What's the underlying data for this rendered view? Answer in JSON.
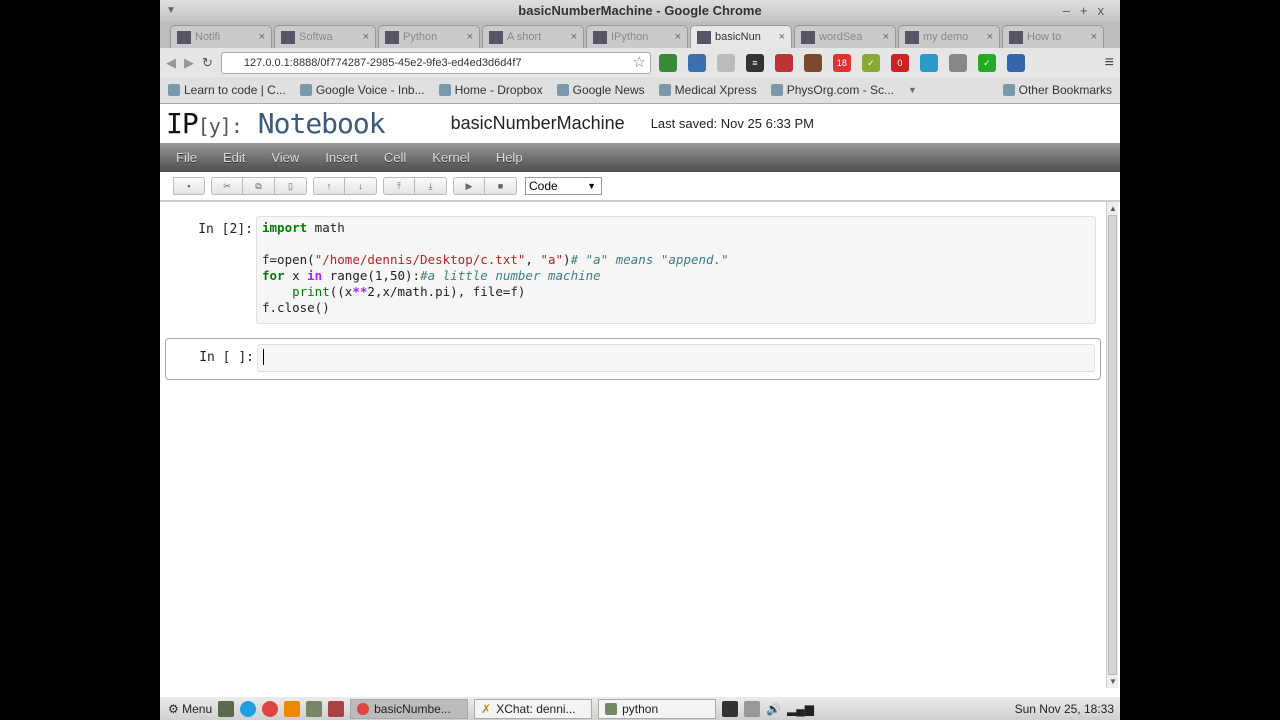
{
  "window": {
    "title": "basicNumberMachine - Google Chrome"
  },
  "tabs": [
    {
      "label": "Notifi",
      "icon": "gmail-icon"
    },
    {
      "label": "Softwa",
      "icon": "power-icon"
    },
    {
      "label": "Python",
      "icon": "google-icon"
    },
    {
      "label": "A short",
      "icon": "grid-icon"
    },
    {
      "label": "IPython",
      "icon": "ipython-icon"
    },
    {
      "label": "basicNun",
      "icon": "ipython-icon",
      "active": true
    },
    {
      "label": "wordSea",
      "icon": "ipython-icon"
    },
    {
      "label": "my demo",
      "icon": "ipython-icon"
    },
    {
      "label": "How to",
      "icon": "page-icon"
    }
  ],
  "address": {
    "url": "127.0.0.1:8888/0f774287-2985-45e2-9fe3-ed4ed3d6d4f7"
  },
  "extensions": [
    {
      "label": "",
      "color": "#3a8a3a"
    },
    {
      "label": "",
      "color": "#3a70b0"
    },
    {
      "label": "",
      "color": "#bbb"
    },
    {
      "label": "≡",
      "color": "#333"
    },
    {
      "label": "",
      "color": "#b33"
    },
    {
      "label": "",
      "color": "#7a4a2a"
    },
    {
      "label": "18",
      "color": "#d33"
    },
    {
      "label": "✓",
      "color": "#8a3"
    },
    {
      "label": "0",
      "color": "#c22"
    },
    {
      "label": "",
      "color": "#2a9ac9"
    },
    {
      "label": "",
      "color": "#888"
    },
    {
      "label": "✓",
      "color": "#2a2"
    },
    {
      "label": "",
      "color": "#36a"
    }
  ],
  "bookmarks": [
    "Learn to code | C...",
    "Google Voice - Inb...",
    "Home - Dropbox",
    "Google News",
    "Medical Xpress",
    "PhysOrg.com - Sc...",
    "Other Bookmarks"
  ],
  "notebook": {
    "logo_ip": "IP",
    "logo_y": "[y]:",
    "logo_nb": "Notebook",
    "name": "basicNumberMachine",
    "last_saved": "Last saved: Nov 25 6:33 PM"
  },
  "menu": [
    "File",
    "Edit",
    "View",
    "Insert",
    "Cell",
    "Kernel",
    "Help"
  ],
  "toolbar": {
    "cell_type": "Code"
  },
  "cells": [
    {
      "prompt": "In [2]:",
      "lines": [
        [
          [
            "import",
            "kw"
          ],
          [
            " math",
            ""
          ]
        ],
        [],
        [
          [
            "f=open(",
            ""
          ],
          [
            "\"/home/dennis/Desktop/c.txt\"",
            "st"
          ],
          [
            ", ",
            ""
          ],
          [
            "\"a\"",
            "st"
          ],
          [
            ")",
            ""
          ],
          [
            "# \"a\" means \"append.\"",
            "cm"
          ]
        ],
        [
          [
            "for",
            "kw"
          ],
          [
            " x ",
            ""
          ],
          [
            "in",
            "op"
          ],
          [
            " range(1,50):",
            ""
          ],
          [
            "#a little number machine",
            "cm"
          ]
        ],
        [
          [
            "    ",
            ""
          ],
          [
            "print",
            "bi"
          ],
          [
            "((x",
            ""
          ],
          [
            "**",
            "op"
          ],
          [
            "2,x/math.pi), file=f)",
            ""
          ]
        ],
        [
          [
            "f.close()",
            ""
          ]
        ]
      ]
    },
    {
      "prompt": "In [ ]:",
      "lines": [
        [
          [
            "",
            ""
          ]
        ]
      ]
    }
  ],
  "taskbar": {
    "menu": "Menu",
    "windows": [
      "basicNumbe...",
      "XChat: denni...",
      "python"
    ],
    "clock": "Sun Nov 25, 18:33"
  }
}
